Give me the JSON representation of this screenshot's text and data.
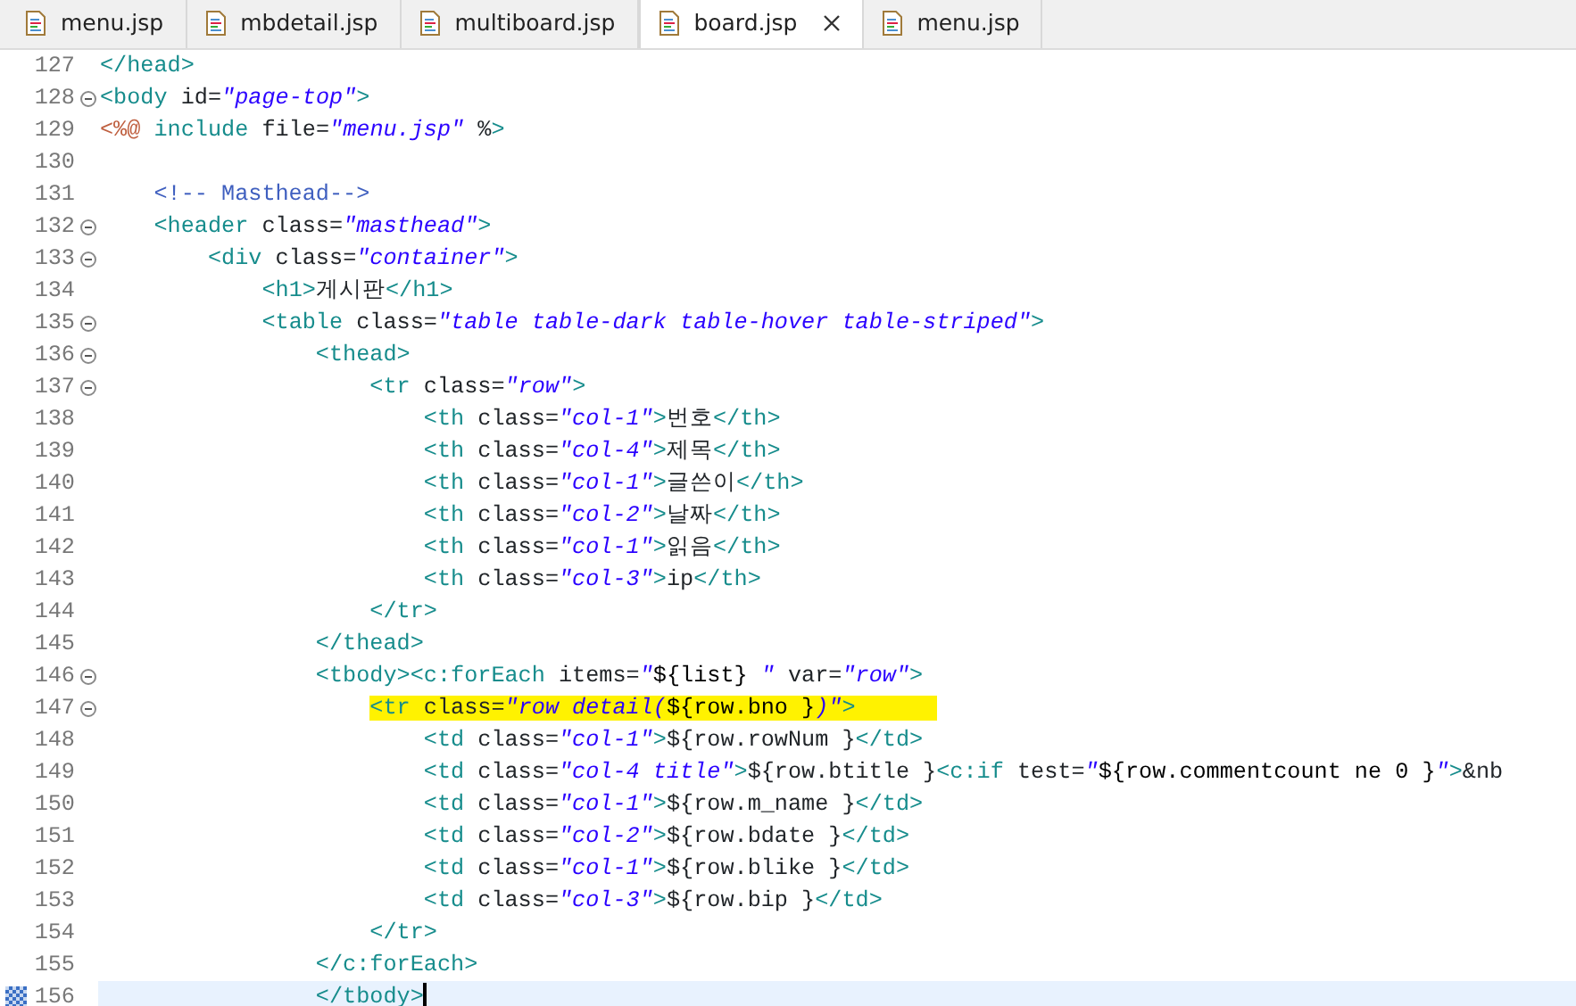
{
  "tabs": [
    {
      "label": "menu.jsp",
      "selected": false
    },
    {
      "label": "mbdetail.jsp",
      "selected": false
    },
    {
      "label": "multiboard.jsp",
      "selected": false
    },
    {
      "label": "board.jsp",
      "selected": true
    },
    {
      "label": "menu.jsp",
      "selected": false
    }
  ],
  "lines": [
    {
      "number": "127",
      "fold": false,
      "highlighted": false,
      "current": false,
      "code": "</head>"
    },
    {
      "number": "128",
      "fold": true,
      "highlighted": false,
      "current": false,
      "code": "<body id=\"page-top\">"
    },
    {
      "number": "129",
      "fold": false,
      "highlighted": false,
      "current": false,
      "code": "<%@ include file=\"menu.jsp\" %>"
    },
    {
      "number": "130",
      "fold": false,
      "highlighted": false,
      "current": false
    },
    {
      "number": "131",
      "fold": false,
      "highlighted": false,
      "current": false,
      "code": "    <!-- Masthead-->"
    },
    {
      "number": "132",
      "fold": true,
      "highlighted": false,
      "current": false,
      "code": "    <header class=\"masthead\">"
    },
    {
      "number": "133",
      "fold": true,
      "highlighted": false,
      "current": false,
      "code": "        <div class=\"container\">"
    },
    {
      "number": "134",
      "fold": false,
      "highlighted": false,
      "current": false,
      "code": "            <h1>게시판</h1>"
    },
    {
      "number": "135",
      "fold": true,
      "highlighted": false,
      "current": false,
      "code": "            <table class=\"table table-dark table-hover table-striped\">"
    },
    {
      "number": "136",
      "fold": true,
      "highlighted": false,
      "current": false,
      "code": "                <thead>"
    },
    {
      "number": "137",
      "fold": true,
      "highlighted": false,
      "current": false,
      "code": "                    <tr class=\"row\">"
    },
    {
      "number": "138",
      "fold": false,
      "highlighted": false,
      "current": false,
      "code": "                        <th class=\"col-1\">번호</th>"
    },
    {
      "number": "139",
      "fold": false,
      "highlighted": false,
      "current": false,
      "code": "                        <th class=\"col-4\">제목</th>"
    },
    {
      "number": "140",
      "fold": false,
      "highlighted": false,
      "current": false,
      "code": "                        <th class=\"col-1\">글쓴이</th>"
    },
    {
      "number": "141",
      "fold": false,
      "highlighted": false,
      "current": false,
      "code": "                        <th class=\"col-2\">날짜</th>"
    },
    {
      "number": "142",
      "fold": false,
      "highlighted": false,
      "current": false,
      "code": "                        <th class=\"col-1\">읽음</th>"
    },
    {
      "number": "143",
      "fold": false,
      "highlighted": false,
      "current": false,
      "code": "                        <th class=\"col-3\">ip</th>"
    },
    {
      "number": "144",
      "fold": false,
      "highlighted": false,
      "current": false,
      "code": "                    </tr>"
    },
    {
      "number": "145",
      "fold": false,
      "highlighted": false,
      "current": false,
      "code": "                </thead>"
    },
    {
      "number": "146",
      "fold": true,
      "highlighted": false,
      "current": false,
      "code": "                <tbody><c:forEach items=\"${list} \" var=\"row\">"
    },
    {
      "number": "147",
      "fold": true,
      "highlighted": true,
      "current": false,
      "code": "                    <tr class=\"row detail(${row.bno })\">"
    },
    {
      "number": "148",
      "fold": false,
      "highlighted": false,
      "current": false,
      "code": "                        <td class=\"col-1\">${row.rowNum }</td>"
    },
    {
      "number": "149",
      "fold": false,
      "highlighted": false,
      "current": false,
      "code": "                        <td class=\"col-4 title\">${row.btitle }<c:if test=\"${row.commentcount ne 0 }\">&nb"
    },
    {
      "number": "150",
      "fold": false,
      "highlighted": false,
      "current": false,
      "code": "                        <td class=\"col-1\">${row.m_name }</td>"
    },
    {
      "number": "151",
      "fold": false,
      "highlighted": false,
      "current": false,
      "code": "                        <td class=\"col-2\">${row.bdate }</td>"
    },
    {
      "number": "152",
      "fold": false,
      "highlighted": false,
      "current": false,
      "code": "                        <td class=\"col-1\">${row.blike }</td>"
    },
    {
      "number": "153",
      "fold": false,
      "highlighted": false,
      "current": false,
      "code": "                        <td class=\"col-3\">${row.bip }</td>"
    },
    {
      "number": "154",
      "fold": false,
      "highlighted": false,
      "current": false,
      "code": "                    </tr>"
    },
    {
      "number": "155",
      "fold": false,
      "highlighted": false,
      "current": false,
      "code": "                </c:forEach>"
    },
    {
      "number": "156",
      "fold": false,
      "highlighted": false,
      "current": true,
      "code": "                </tbody>"
    }
  ]
}
